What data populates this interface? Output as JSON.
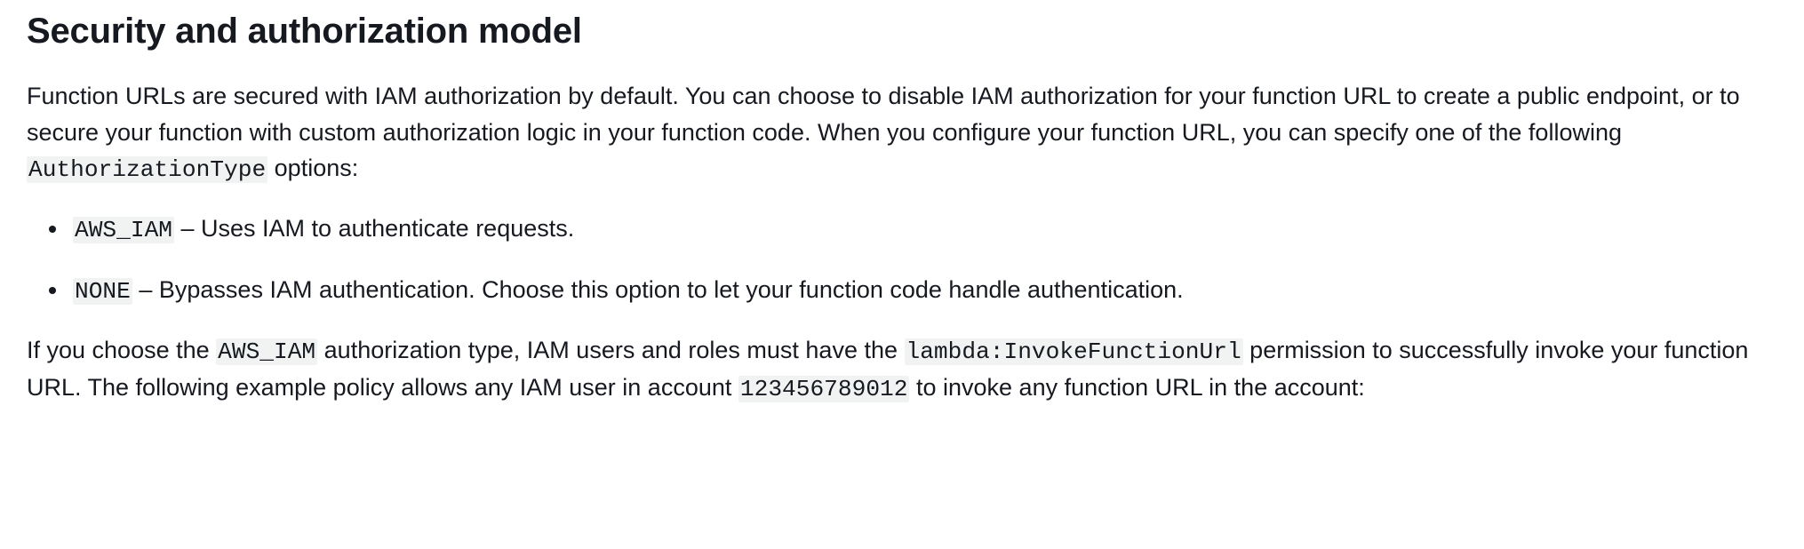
{
  "heading": "Security and authorization model",
  "intro": {
    "pre": "Function URLs are secured with IAM authorization by default. You can choose to disable IAM authorization for your function URL to create a public endpoint, or to secure your function with custom authorization logic in your function code. When you configure your function URL, you can specify one of the following ",
    "code": "AuthorizationType",
    "post": " options:"
  },
  "options": [
    {
      "code": "AWS_IAM",
      "desc": " – Uses IAM to authenticate requests."
    },
    {
      "code": "NONE",
      "desc": " – Bypasses IAM authentication. Choose this option to let your function code handle authentication."
    }
  ],
  "policy_para": {
    "t1": "If you choose the ",
    "c1": "AWS_IAM",
    "t2": " authorization type, IAM users and roles must have the ",
    "c2": "lambda:InvokeFunctionUrl",
    "t3": " permission to successfully invoke your function URL. The following example policy allows any IAM user in account ",
    "c3": "123456789012",
    "t4": " to invoke any function URL in the account:"
  }
}
